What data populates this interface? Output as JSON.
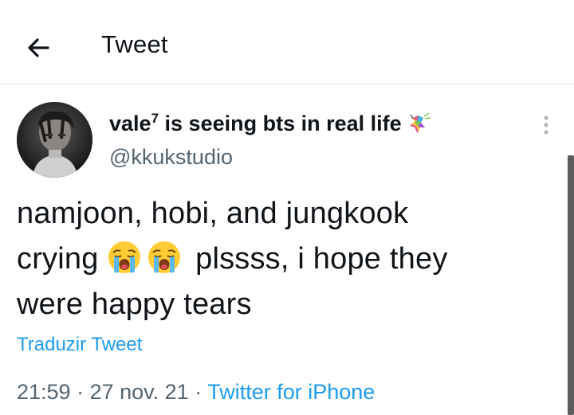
{
  "header": {
    "title": "Tweet",
    "back_icon": "arrow-left-icon"
  },
  "author": {
    "display_name": "vale",
    "superscript": "7",
    "name_suffix": " is seeing bts in real life",
    "name_emoji": "pinata-icon",
    "handle": "@kkukstudio"
  },
  "tweet": {
    "line1": "namjoon, hobi, and jungkook",
    "line2_before": "crying",
    "emoji": "loudly-crying-face-icon",
    "line2_after": "plssss, i hope they",
    "line3": "were happy tears",
    "translate_label": "Traduzir Tweet"
  },
  "meta": {
    "time": "21:59",
    "separator1": " · ",
    "date": "27 nov. 21",
    "separator2": " · ",
    "source": "Twitter for iPhone"
  },
  "colors": {
    "accent": "#1d9bf0",
    "secondary_text": "#536471",
    "text": "#0f1419"
  }
}
